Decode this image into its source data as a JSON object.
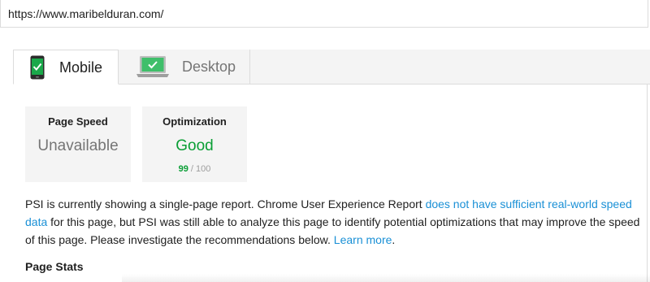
{
  "url_bar": {
    "url": "https://www.maribelduran.com/"
  },
  "tabs": [
    {
      "label": "Mobile",
      "icon": "phone-check-icon",
      "active": true
    },
    {
      "label": "Desktop",
      "icon": "laptop-check-icon",
      "active": false
    }
  ],
  "metrics": {
    "page_speed": {
      "title": "Page Speed",
      "value": "Unavailable"
    },
    "optimization": {
      "title": "Optimization",
      "value": "Good",
      "score": "99",
      "score_max": "/ 100"
    }
  },
  "info": {
    "text_before": "PSI is currently showing a single-page report. Chrome User Experience Report ",
    "link1": "does not have sufficient real-world speed data",
    "text_middle": " for this page, but PSI was still able to analyze this page to identify potential optimizations that may improve the speed of this page. Please investigate the recommendations below. ",
    "link2": "Learn more",
    "text_after": "."
  },
  "page_stats": {
    "heading": "Page Stats"
  },
  "colors": {
    "good_green": "#0a9e35",
    "link_blue": "#1a90d6",
    "card_gray": "#f4f4f4",
    "muted_text": "#757575"
  }
}
